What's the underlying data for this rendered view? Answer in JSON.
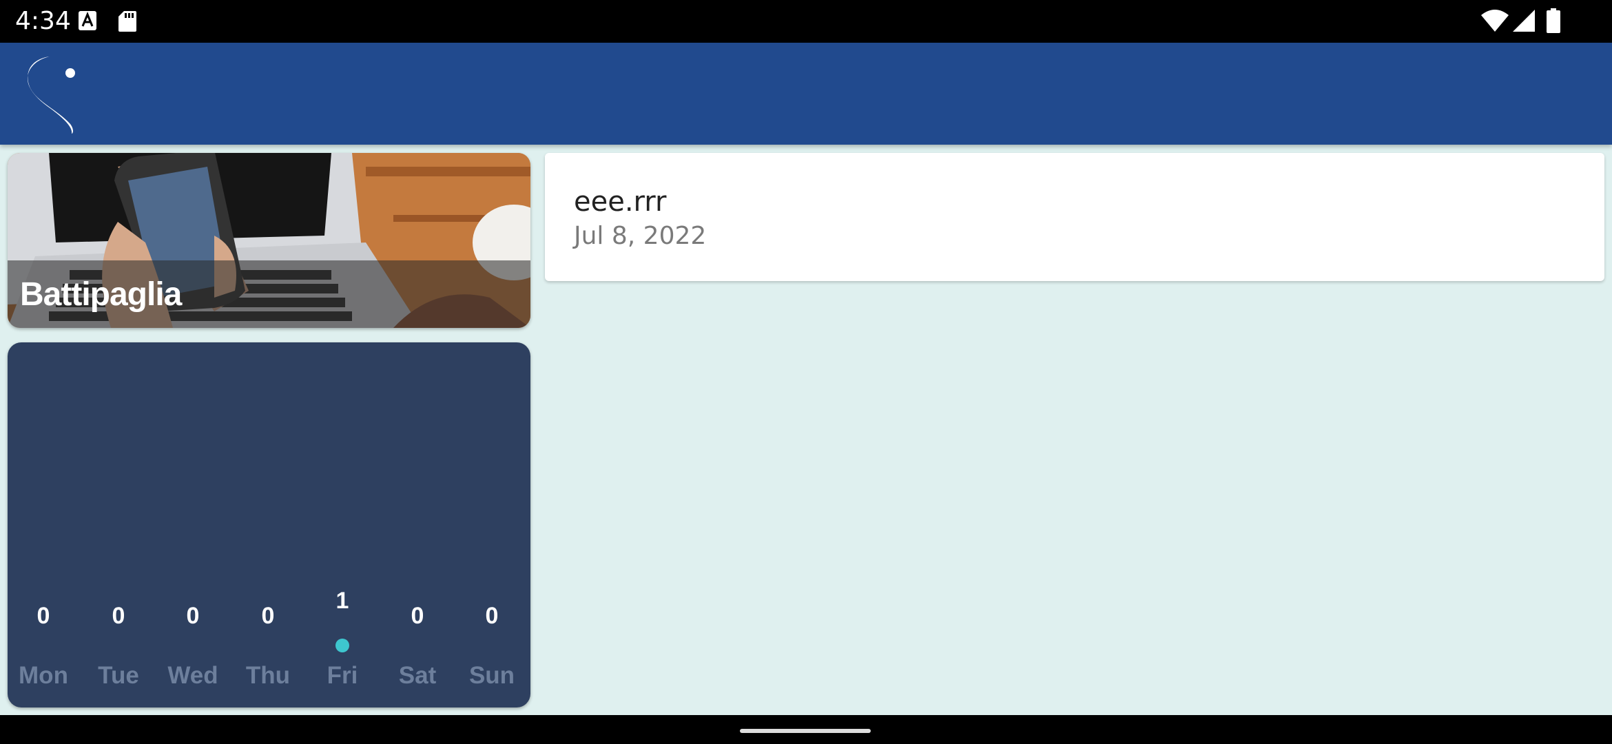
{
  "status_bar": {
    "time": "4:34",
    "icons": [
      "font-a-icon",
      "sd-card-icon",
      "wifi-icon",
      "signal-icon",
      "battery-icon"
    ]
  },
  "app_bar": {
    "logo": "s-logo"
  },
  "location_card": {
    "name": "Battipaglia"
  },
  "weekly_activity": {
    "days": [
      {
        "label": "Mon",
        "count": "0",
        "active": false
      },
      {
        "label": "Tue",
        "count": "0",
        "active": false
      },
      {
        "label": "Wed",
        "count": "0",
        "active": false
      },
      {
        "label": "Thu",
        "count": "0",
        "active": false
      },
      {
        "label": "Fri",
        "count": "1",
        "active": true
      },
      {
        "label": "Sat",
        "count": "0",
        "active": false
      },
      {
        "label": "Sun",
        "count": "0",
        "active": false
      }
    ],
    "dot_color": "#3ec6cf"
  },
  "entries": [
    {
      "title": "eee.rrr",
      "date": "Jul 8, 2022"
    }
  ],
  "colors": {
    "app_bar": "#214a8e",
    "background": "#dff0ef",
    "card_dark": "#2e4060"
  }
}
